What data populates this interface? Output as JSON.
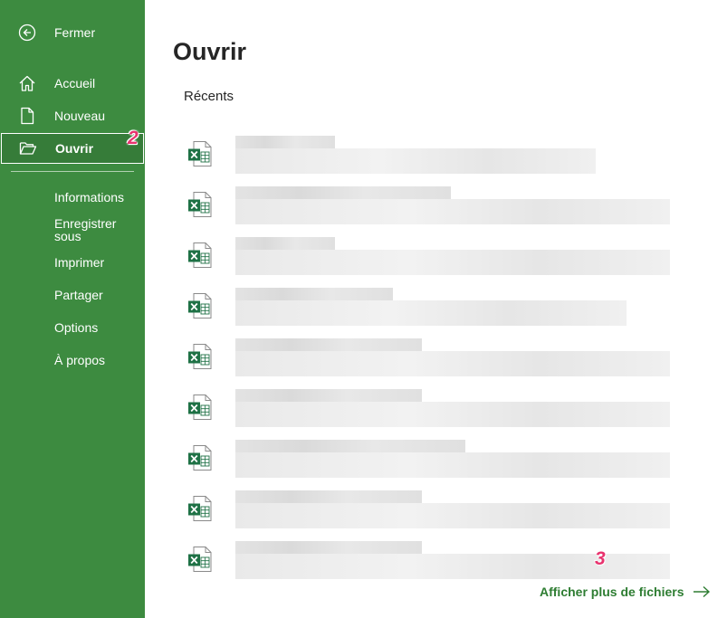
{
  "sidebar": {
    "close_label": "Fermer",
    "nav": {
      "home_label": "Accueil",
      "new_label": "Nouveau",
      "open_label": "Ouvrir"
    },
    "info_label": "Informations",
    "save_as_label": "Enregistrer sous",
    "save_as_line1": "Enregistrer",
    "save_as_line2": "sous",
    "print_label": "Imprimer",
    "share_label": "Partager",
    "options_label": "Options",
    "about_label": "À propos"
  },
  "annotations": {
    "step_open": "2",
    "step_more": "3",
    "color": "#e8336e"
  },
  "main": {
    "title": "Ouvrir",
    "section_label": "Récents",
    "recent_files": [
      {
        "icon": "excel-file-icon",
        "name": "",
        "path": ""
      },
      {
        "icon": "excel-file-icon",
        "name": "",
        "path": ""
      },
      {
        "icon": "excel-file-icon",
        "name": "",
        "path": ""
      },
      {
        "icon": "excel-file-icon",
        "name": "",
        "path": ""
      },
      {
        "icon": "excel-file-icon",
        "name": "",
        "path": ""
      },
      {
        "icon": "excel-file-icon",
        "name": "",
        "path": ""
      },
      {
        "icon": "excel-file-icon",
        "name": "",
        "path": ""
      },
      {
        "icon": "excel-file-icon",
        "name": "",
        "path": ""
      },
      {
        "icon": "excel-file-icon",
        "name": "",
        "path": ""
      }
    ],
    "more_files_label": "Afficher plus de fichiers"
  },
  "colors": {
    "sidebar_bg": "#3d8b40",
    "accent_link": "#2e7d32",
    "excel_green": "#1e7145"
  }
}
